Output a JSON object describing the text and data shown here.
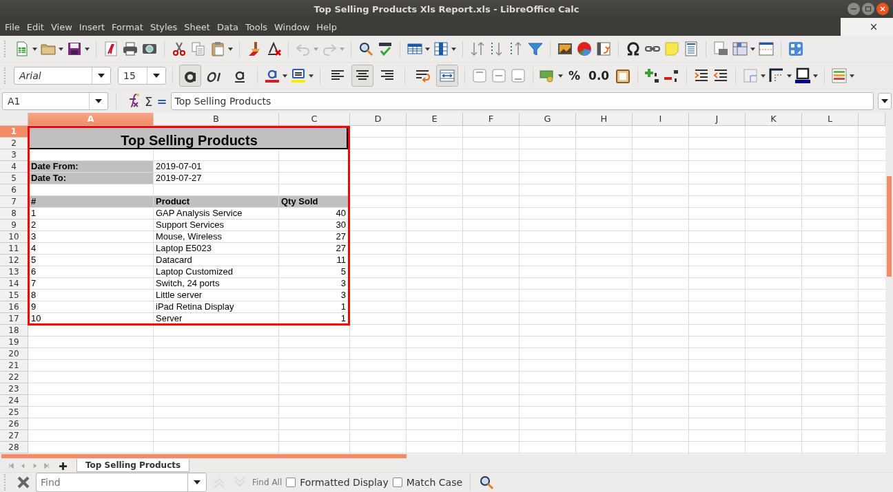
{
  "window": {
    "title": "Top Selling Products Xls Report.xls - LibreOffice Calc"
  },
  "menu": [
    "File",
    "Edit",
    "View",
    "Insert",
    "Format",
    "Styles",
    "Sheet",
    "Data",
    "Tools",
    "Window",
    "Help"
  ],
  "document_close": "×",
  "history": [
    {
      "kind": "undo",
      "disabled": true
    },
    {
      "kind": "redo",
      "disabled": true
    }
  ],
  "font_name": {
    "value": "Arial"
  },
  "font_size": {
    "value": "15"
  },
  "format_toggles": [
    {
      "kind": "bold",
      "on": true
    },
    {
      "kind": "italic",
      "on": false
    },
    {
      "kind": "underline",
      "on": false
    }
  ],
  "align_toggles": [
    {
      "kind": "left",
      "on": false
    },
    {
      "kind": "center",
      "on": true
    },
    {
      "kind": "right",
      "on": false
    }
  ],
  "cell_toggles": [
    {
      "kind": "wrap",
      "on": false
    },
    {
      "kind": "merge",
      "on": true
    }
  ],
  "number_formats": [
    {
      "label": "%"
    },
    {
      "label": "0.0"
    }
  ],
  "name_box": {
    "value": "A1"
  },
  "formula_symbols": [
    "Σ",
    "="
  ],
  "formula": {
    "value": "Top Selling Products"
  },
  "sheet": {
    "columns": [
      {
        "label": "A",
        "selected": true
      },
      {
        "label": "B",
        "selected": false
      },
      {
        "label": "C",
        "selected": false
      },
      {
        "label": "D",
        "selected": false
      },
      {
        "label": "E",
        "selected": false
      },
      {
        "label": "F",
        "selected": false
      },
      {
        "label": "G",
        "selected": false
      },
      {
        "label": "H",
        "selected": false
      },
      {
        "label": "I",
        "selected": false
      },
      {
        "label": "J",
        "selected": false
      },
      {
        "label": "K",
        "selected": false
      },
      {
        "label": "L",
        "selected": false
      }
    ],
    "title": "Top Selling Products",
    "rows": [
      {
        "label": "1",
        "selected": true
      },
      {
        "label": "2",
        "selected": false
      },
      {
        "label": "3",
        "selected": false
      },
      {
        "label": "4",
        "selected": false,
        "cells": [
          {
            "text": "Date From:",
            "kind": "label"
          },
          {
            "text": "2019-07-01",
            "kind": "text"
          }
        ]
      },
      {
        "label": "5",
        "selected": false,
        "cells": [
          {
            "text": "Date To:",
            "kind": "label"
          },
          {
            "text": "2019-07-27",
            "kind": "text"
          }
        ]
      },
      {
        "label": "6",
        "selected": false
      },
      {
        "label": "7",
        "selected": false,
        "cells": [
          {
            "text": "#",
            "kind": "label"
          },
          {
            "text": "Product",
            "kind": "label"
          },
          {
            "text": "Qty Sold",
            "kind": "label"
          }
        ]
      },
      {
        "label": "8",
        "selected": false,
        "cells": [
          {
            "text": "1",
            "kind": "text"
          },
          {
            "text": "GAP Analysis Service",
            "kind": "text"
          },
          {
            "text": "40",
            "kind": "number"
          }
        ]
      },
      {
        "label": "9",
        "selected": false,
        "cells": [
          {
            "text": "2",
            "kind": "text"
          },
          {
            "text": "Support Services",
            "kind": "text"
          },
          {
            "text": "30",
            "kind": "number"
          }
        ]
      },
      {
        "label": "10",
        "selected": false,
        "cells": [
          {
            "text": "3",
            "kind": "text"
          },
          {
            "text": "Mouse, Wireless",
            "kind": "text"
          },
          {
            "text": "27",
            "kind": "number"
          }
        ]
      },
      {
        "label": "11",
        "selected": false,
        "cells": [
          {
            "text": "4",
            "kind": "text"
          },
          {
            "text": "Laptop E5023",
            "kind": "text"
          },
          {
            "text": "27",
            "kind": "number"
          }
        ]
      },
      {
        "label": "12",
        "selected": false,
        "cells": [
          {
            "text": "5",
            "kind": "text"
          },
          {
            "text": "Datacard",
            "kind": "text"
          },
          {
            "text": "11",
            "kind": "number"
          }
        ]
      },
      {
        "label": "13",
        "selected": false,
        "cells": [
          {
            "text": "6",
            "kind": "text"
          },
          {
            "text": "Laptop Customized",
            "kind": "text"
          },
          {
            "text": "5",
            "kind": "number"
          }
        ]
      },
      {
        "label": "14",
        "selected": false,
        "cells": [
          {
            "text": "7",
            "kind": "text"
          },
          {
            "text": "Switch, 24 ports",
            "kind": "text"
          },
          {
            "text": "3",
            "kind": "number"
          }
        ]
      },
      {
        "label": "15",
        "selected": false,
        "cells": [
          {
            "text": "8",
            "kind": "text"
          },
          {
            "text": "Little server",
            "kind": "text"
          },
          {
            "text": "3",
            "kind": "number"
          }
        ]
      },
      {
        "label": "16",
        "selected": false,
        "cells": [
          {
            "text": "9",
            "kind": "text"
          },
          {
            "text": "iPad Retina Display",
            "kind": "text"
          },
          {
            "text": "1",
            "kind": "number"
          }
        ]
      },
      {
        "label": "17",
        "selected": false,
        "cells": [
          {
            "text": "10",
            "kind": "text"
          },
          {
            "text": "Server",
            "kind": "text"
          },
          {
            "text": "1",
            "kind": "number"
          }
        ]
      },
      {
        "label": "18",
        "selected": false
      },
      {
        "label": "19",
        "selected": false
      },
      {
        "label": "20",
        "selected": false
      },
      {
        "label": "21",
        "selected": false
      },
      {
        "label": "22",
        "selected": false
      },
      {
        "label": "23",
        "selected": false
      },
      {
        "label": "24",
        "selected": false
      },
      {
        "label": "25",
        "selected": false
      },
      {
        "label": "26",
        "selected": false
      },
      {
        "label": "27",
        "selected": false
      },
      {
        "label": "28",
        "selected": false
      }
    ]
  },
  "sheet_tabs": [
    {
      "label": "Top Selling Products",
      "selected": true
    }
  ],
  "find_bar": {
    "placeholder": "Find",
    "nav": [
      {
        "kind": "up",
        "disabled": true
      },
      {
        "kind": "down",
        "disabled": true
      }
    ],
    "find_all": "Find All",
    "options": [
      {
        "label": "Formatted Display",
        "checked": false
      },
      {
        "label": "Match Case",
        "checked": false
      }
    ]
  }
}
